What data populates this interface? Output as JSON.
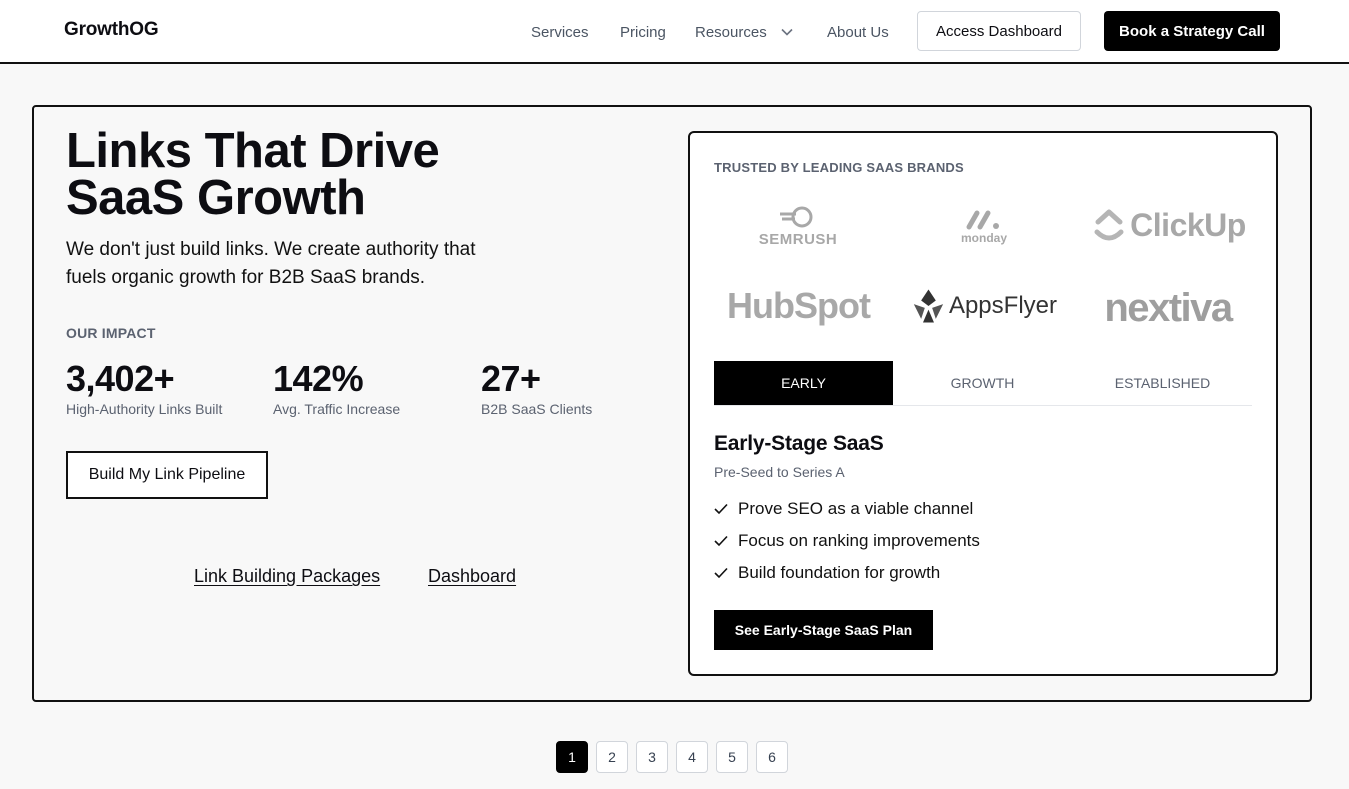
{
  "nav": {
    "brand": "GrowthOG",
    "links": [
      "Services",
      "Pricing",
      "Resources",
      "About Us"
    ],
    "access_label": "Access Dashboard",
    "book_label": "Book a Strategy Call"
  },
  "hero": {
    "title": "Links That Drive SaaS Growth",
    "subtitle": "We don't just build links. We create authority that fuels organic growth for B2B SaaS brands.",
    "impact_label": "OUR IMPACT",
    "stats": [
      {
        "value": "3,402+",
        "label": "High-Authority Links Built"
      },
      {
        "value": "142%",
        "label": "Avg. Traffic Increase"
      },
      {
        "value": "27+",
        "label": "B2B SaaS Clients"
      }
    ],
    "cta_label": "Build My Link Pipeline",
    "links": [
      "Link Building Packages",
      "Dashboard"
    ]
  },
  "panel": {
    "trusted_label": "TRUSTED BY LEADING SAAS BRANDS",
    "logos": [
      "SEMRUSH",
      "monday",
      "ClickUp",
      "HubSpot",
      "AppsFlyer",
      "nextiva"
    ],
    "tabs": [
      "EARLY",
      "GROWTH",
      "ESTABLISHED"
    ],
    "active_tab": "EARLY",
    "stage_title": "Early-Stage SaaS",
    "stage_sub": "Pre-Seed to Series A",
    "bullets": [
      "Prove SEO as a viable channel",
      "Focus on ranking improvements",
      "Build foundation for growth"
    ],
    "plan_label": "See Early-Stage SaaS Plan"
  },
  "pagination": {
    "pages": [
      "1",
      "2",
      "3",
      "4",
      "5",
      "6"
    ],
    "current": "1"
  },
  "colors": {
    "accent": "#000000",
    "muted": "#5b6270",
    "logo_gray": "#a8a8a8"
  }
}
